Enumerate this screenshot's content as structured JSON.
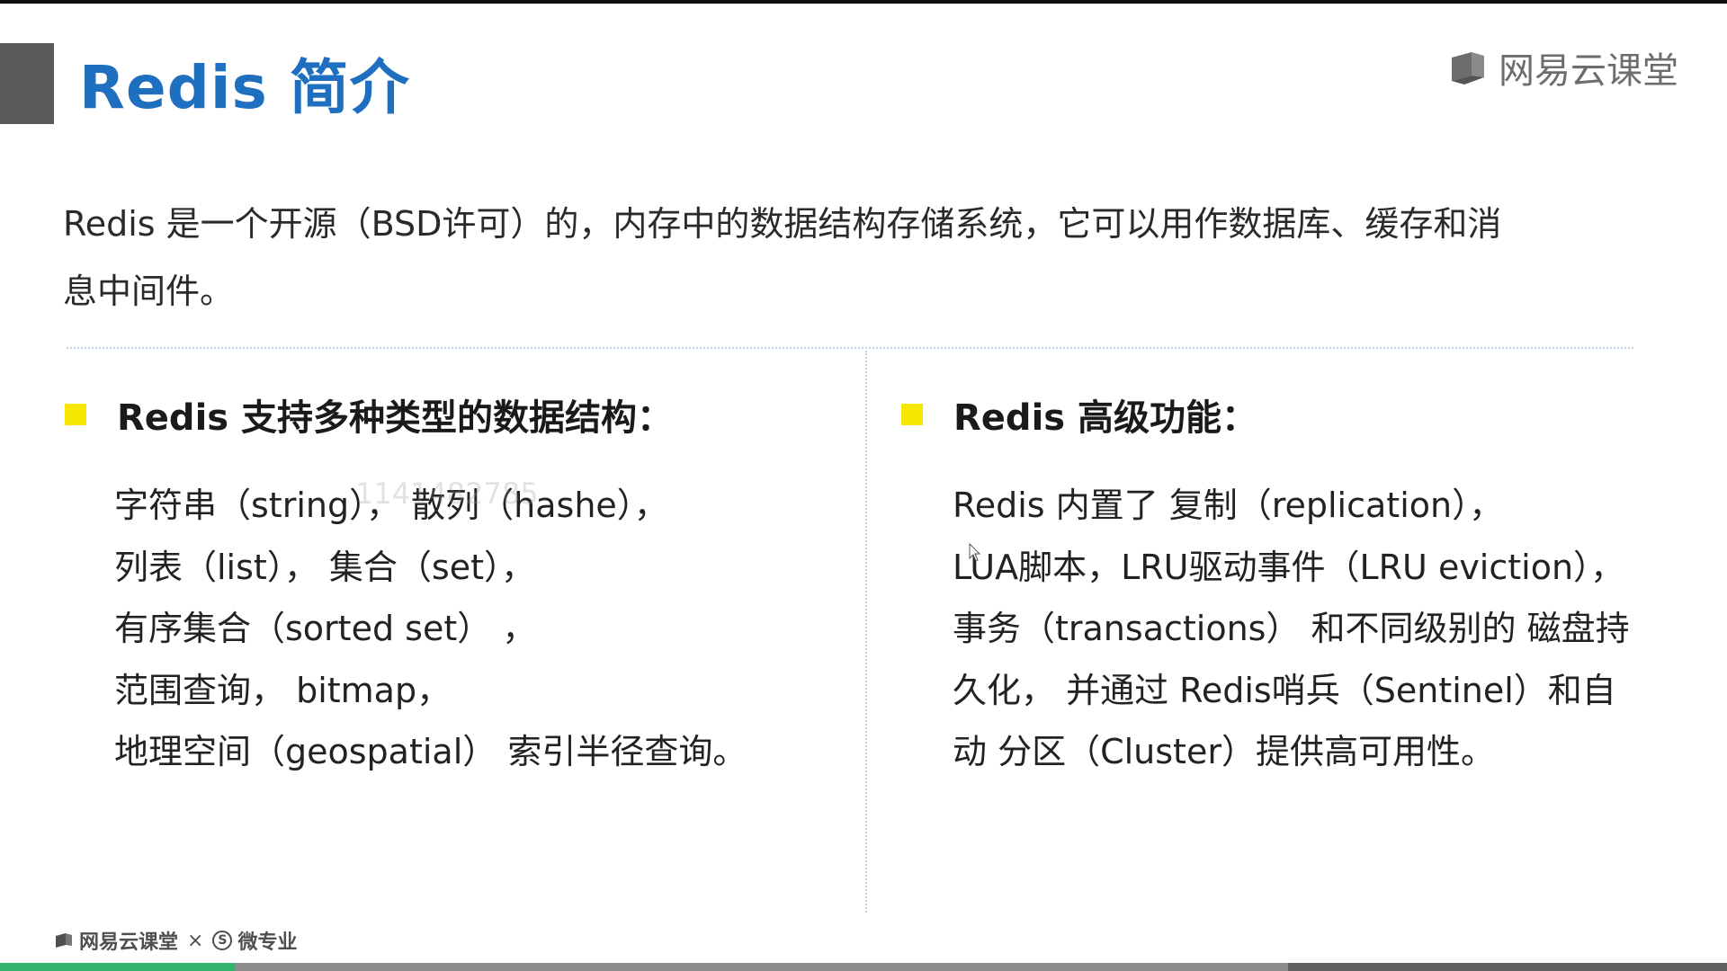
{
  "slide": {
    "title": "Redis 简介",
    "brand": "网易云课堂",
    "intro_line1": "Redis 是一个开源（BSD许可）的，内存中的数据结构存储系统，它可以用作数据库、缓存和消",
    "intro_line2": "息中间件。"
  },
  "left_column": {
    "heading": "Redis 支持多种类型的数据结构：",
    "items": [
      "字符串（string），  散列（hashe），",
      "列表（list），  集合（set），",
      "有序集合（sorted set）  ，",
      "范围查询，  bitmap，",
      "地理空间（geospatial） 索引半径查询。"
    ]
  },
  "right_column": {
    "heading": "Redis 高级功能：",
    "items": [
      "Redis 内置了 复制（replication），",
      "LUA脚本，LRU驱动事件（LRU eviction），",
      "事务（transactions） 和不同级别的 磁盘持",
      "久化， 并通过 Redis哨兵（Sentinel）和自",
      "动 分区（Cluster）提供高可用性。"
    ]
  },
  "watermark": "1141482785",
  "footer": {
    "brand": "网易云课堂",
    "separator": "×",
    "partner_symbol": "S",
    "partner": "微专业"
  },
  "video_progress": {
    "played_fraction": 0.136,
    "buffered_fraction": 0.746
  },
  "colors": {
    "title": "#1e6fc0",
    "bullet": "#f6e600",
    "divider": "#b8d3ea",
    "progress_played": "#33b36b"
  },
  "icons": {
    "brand": "book-logo-icon",
    "bullet": "square-bullet-icon",
    "cursor": "mouse-pointer-icon"
  }
}
